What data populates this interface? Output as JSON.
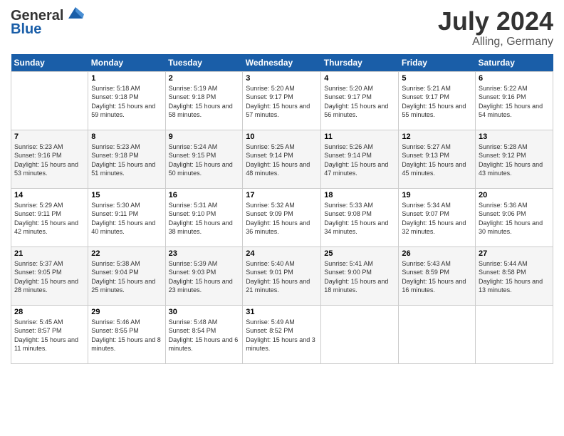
{
  "header": {
    "logo_line1": "General",
    "logo_line2": "Blue",
    "month_year": "July 2024",
    "location": "Alling, Germany"
  },
  "weekdays": [
    "Sunday",
    "Monday",
    "Tuesday",
    "Wednesday",
    "Thursday",
    "Friday",
    "Saturday"
  ],
  "weeks": [
    [
      {
        "day": "",
        "sunrise": "",
        "sunset": "",
        "daylight": ""
      },
      {
        "day": "1",
        "sunrise": "Sunrise: 5:18 AM",
        "sunset": "Sunset: 9:18 PM",
        "daylight": "Daylight: 15 hours and 59 minutes."
      },
      {
        "day": "2",
        "sunrise": "Sunrise: 5:19 AM",
        "sunset": "Sunset: 9:18 PM",
        "daylight": "Daylight: 15 hours and 58 minutes."
      },
      {
        "day": "3",
        "sunrise": "Sunrise: 5:20 AM",
        "sunset": "Sunset: 9:17 PM",
        "daylight": "Daylight: 15 hours and 57 minutes."
      },
      {
        "day": "4",
        "sunrise": "Sunrise: 5:20 AM",
        "sunset": "Sunset: 9:17 PM",
        "daylight": "Daylight: 15 hours and 56 minutes."
      },
      {
        "day": "5",
        "sunrise": "Sunrise: 5:21 AM",
        "sunset": "Sunset: 9:17 PM",
        "daylight": "Daylight: 15 hours and 55 minutes."
      },
      {
        "day": "6",
        "sunrise": "Sunrise: 5:22 AM",
        "sunset": "Sunset: 9:16 PM",
        "daylight": "Daylight: 15 hours and 54 minutes."
      }
    ],
    [
      {
        "day": "7",
        "sunrise": "Sunrise: 5:23 AM",
        "sunset": "Sunset: 9:16 PM",
        "daylight": "Daylight: 15 hours and 53 minutes."
      },
      {
        "day": "8",
        "sunrise": "Sunrise: 5:23 AM",
        "sunset": "Sunset: 9:18 PM",
        "daylight": "Daylight: 15 hours and 51 minutes."
      },
      {
        "day": "9",
        "sunrise": "Sunrise: 5:24 AM",
        "sunset": "Sunset: 9:15 PM",
        "daylight": "Daylight: 15 hours and 50 minutes."
      },
      {
        "day": "10",
        "sunrise": "Sunrise: 5:25 AM",
        "sunset": "Sunset: 9:14 PM",
        "daylight": "Daylight: 15 hours and 48 minutes."
      },
      {
        "day": "11",
        "sunrise": "Sunrise: 5:26 AM",
        "sunset": "Sunset: 9:14 PM",
        "daylight": "Daylight: 15 hours and 47 minutes."
      },
      {
        "day": "12",
        "sunrise": "Sunrise: 5:27 AM",
        "sunset": "Sunset: 9:13 PM",
        "daylight": "Daylight: 15 hours and 45 minutes."
      },
      {
        "day": "13",
        "sunrise": "Sunrise: 5:28 AM",
        "sunset": "Sunset: 9:12 PM",
        "daylight": "Daylight: 15 hours and 43 minutes."
      }
    ],
    [
      {
        "day": "14",
        "sunrise": "Sunrise: 5:29 AM",
        "sunset": "Sunset: 9:11 PM",
        "daylight": "Daylight: 15 hours and 42 minutes."
      },
      {
        "day": "15",
        "sunrise": "Sunrise: 5:30 AM",
        "sunset": "Sunset: 9:11 PM",
        "daylight": "Daylight: 15 hours and 40 minutes."
      },
      {
        "day": "16",
        "sunrise": "Sunrise: 5:31 AM",
        "sunset": "Sunset: 9:10 PM",
        "daylight": "Daylight: 15 hours and 38 minutes."
      },
      {
        "day": "17",
        "sunrise": "Sunrise: 5:32 AM",
        "sunset": "Sunset: 9:09 PM",
        "daylight": "Daylight: 15 hours and 36 minutes."
      },
      {
        "day": "18",
        "sunrise": "Sunrise: 5:33 AM",
        "sunset": "Sunset: 9:08 PM",
        "daylight": "Daylight: 15 hours and 34 minutes."
      },
      {
        "day": "19",
        "sunrise": "Sunrise: 5:34 AM",
        "sunset": "Sunset: 9:07 PM",
        "daylight": "Daylight: 15 hours and 32 minutes."
      },
      {
        "day": "20",
        "sunrise": "Sunrise: 5:36 AM",
        "sunset": "Sunset: 9:06 PM",
        "daylight": "Daylight: 15 hours and 30 minutes."
      }
    ],
    [
      {
        "day": "21",
        "sunrise": "Sunrise: 5:37 AM",
        "sunset": "Sunset: 9:05 PM",
        "daylight": "Daylight: 15 hours and 28 minutes."
      },
      {
        "day": "22",
        "sunrise": "Sunrise: 5:38 AM",
        "sunset": "Sunset: 9:04 PM",
        "daylight": "Daylight: 15 hours and 25 minutes."
      },
      {
        "day": "23",
        "sunrise": "Sunrise: 5:39 AM",
        "sunset": "Sunset: 9:03 PM",
        "daylight": "Daylight: 15 hours and 23 minutes."
      },
      {
        "day": "24",
        "sunrise": "Sunrise: 5:40 AM",
        "sunset": "Sunset: 9:01 PM",
        "daylight": "Daylight: 15 hours and 21 minutes."
      },
      {
        "day": "25",
        "sunrise": "Sunrise: 5:41 AM",
        "sunset": "Sunset: 9:00 PM",
        "daylight": "Daylight: 15 hours and 18 minutes."
      },
      {
        "day": "26",
        "sunrise": "Sunrise: 5:43 AM",
        "sunset": "Sunset: 8:59 PM",
        "daylight": "Daylight: 15 hours and 16 minutes."
      },
      {
        "day": "27",
        "sunrise": "Sunrise: 5:44 AM",
        "sunset": "Sunset: 8:58 PM",
        "daylight": "Daylight: 15 hours and 13 minutes."
      }
    ],
    [
      {
        "day": "28",
        "sunrise": "Sunrise: 5:45 AM",
        "sunset": "Sunset: 8:57 PM",
        "daylight": "Daylight: 15 hours and 11 minutes."
      },
      {
        "day": "29",
        "sunrise": "Sunrise: 5:46 AM",
        "sunset": "Sunset: 8:55 PM",
        "daylight": "Daylight: 15 hours and 8 minutes."
      },
      {
        "day": "30",
        "sunrise": "Sunrise: 5:48 AM",
        "sunset": "Sunset: 8:54 PM",
        "daylight": "Daylight: 15 hours and 6 minutes."
      },
      {
        "day": "31",
        "sunrise": "Sunrise: 5:49 AM",
        "sunset": "Sunset: 8:52 PM",
        "daylight": "Daylight: 15 hours and 3 minutes."
      },
      {
        "day": "",
        "sunrise": "",
        "sunset": "",
        "daylight": ""
      },
      {
        "day": "",
        "sunrise": "",
        "sunset": "",
        "daylight": ""
      },
      {
        "day": "",
        "sunrise": "",
        "sunset": "",
        "daylight": ""
      }
    ]
  ]
}
